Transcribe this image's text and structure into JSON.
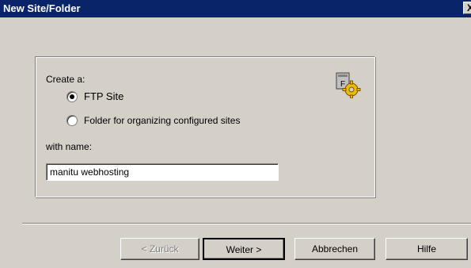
{
  "window": {
    "title": "New Site/Folder",
    "close_glyph": "X"
  },
  "form": {
    "create_label": "Create a:",
    "options": [
      {
        "label": "FTP Site",
        "checked": true
      },
      {
        "label": "Folder for organizing configured sites",
        "checked": false
      }
    ],
    "name_label": "with name:",
    "name_value": "manitu webhosting",
    "icon": "wizard-gear-icon"
  },
  "buttons": {
    "back": "< Zurück",
    "next": "Weiter >",
    "cancel": "Abbrechen",
    "help": "Hilfe"
  }
}
